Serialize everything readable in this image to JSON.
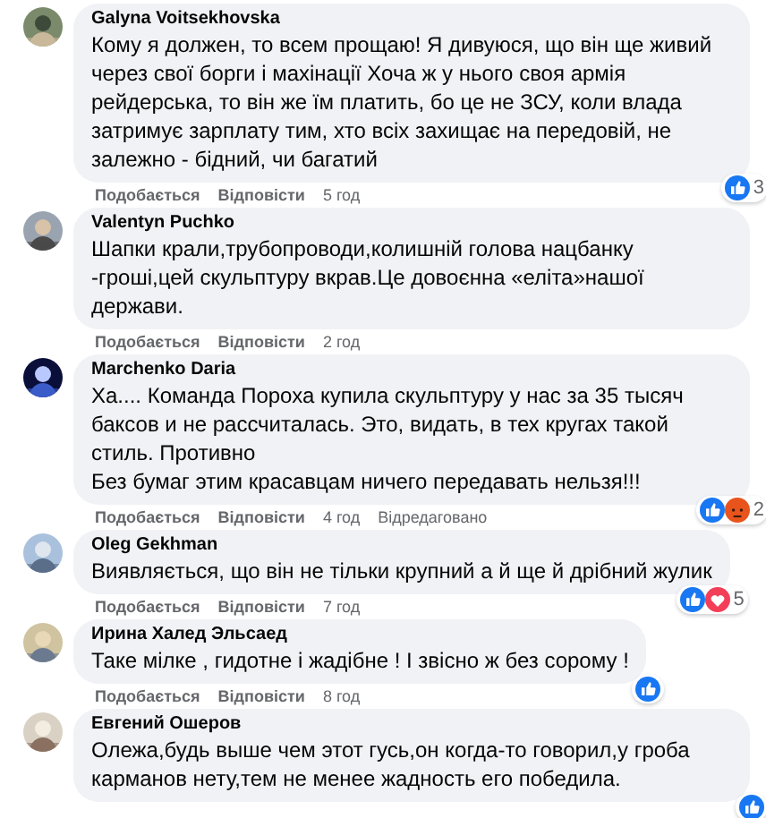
{
  "comments": [
    {
      "author": "Galyna Voitsekhovska",
      "text": "Кому я должен, то всем прощаю! Я дивуюся, що він ще живий через свої борги і махінації Хоча ж у нього своя армія рейдерська, то він же їм платить, бо це не ЗСУ, коли влада затримує зарплату тим, хто всіх захищає на передовій, не залежно - бідний, чи багатий",
      "reactions": [
        {
          "kind": "like"
        }
      ],
      "reaction_count": "3",
      "actions": {
        "like": "Подобається",
        "reply": "Відповісти",
        "time": "5 год"
      }
    },
    {
      "author": "Valentyn Puchko",
      "text": "Шапки крали,трубопроводи,колишній голова нацбанку -гроші,цей скульптуру вкрав.Це довоєнна «еліта»нашої держави.",
      "actions": {
        "like": "Подобається",
        "reply": "Відповісти",
        "time": "2 год"
      }
    },
    {
      "author": "Marchenko Daria",
      "text": "Ха.... Команда Пороха купила скульптуру у нас за 35 тысяч баксов и не рассчиталась. Это, видать, в тех кругах такой стиль. Противно\nБез бумаг этим красавцам ничего передавать нельзя!!!",
      "reactions": [
        {
          "kind": "like"
        },
        {
          "kind": "angry"
        }
      ],
      "reaction_count": "2",
      "actions": {
        "like": "Подобається",
        "reply": "Відповісти",
        "time": "4 год",
        "edited": "Відредаговано"
      }
    },
    {
      "author": "Oleg Gekhman",
      "text": "Виявляється, що він не тільки крупний а й ще й дрібний жулик",
      "reactions": [
        {
          "kind": "like"
        },
        {
          "kind": "love"
        }
      ],
      "reaction_count": "5",
      "actions": {
        "like": "Подобається",
        "reply": "Відповісти",
        "time": "7 год"
      }
    },
    {
      "author": "Ирина Халед Эльсаед",
      "text": "Таке мілке , гидотне і жадібне ! І звісно ж без сорому !",
      "reactions": [
        {
          "kind": "like"
        }
      ],
      "actions": {
        "like": "Подобається",
        "reply": "Відповісти",
        "time": "8 год"
      }
    },
    {
      "author": "Евгений Ошеров",
      "text": "Олежа,будь выше чем этот гусь,он когда-то говорил,у гроба карманов нету,тем не менее жадность его победила.",
      "reactions": [
        {
          "kind": "like"
        }
      ]
    }
  ]
}
